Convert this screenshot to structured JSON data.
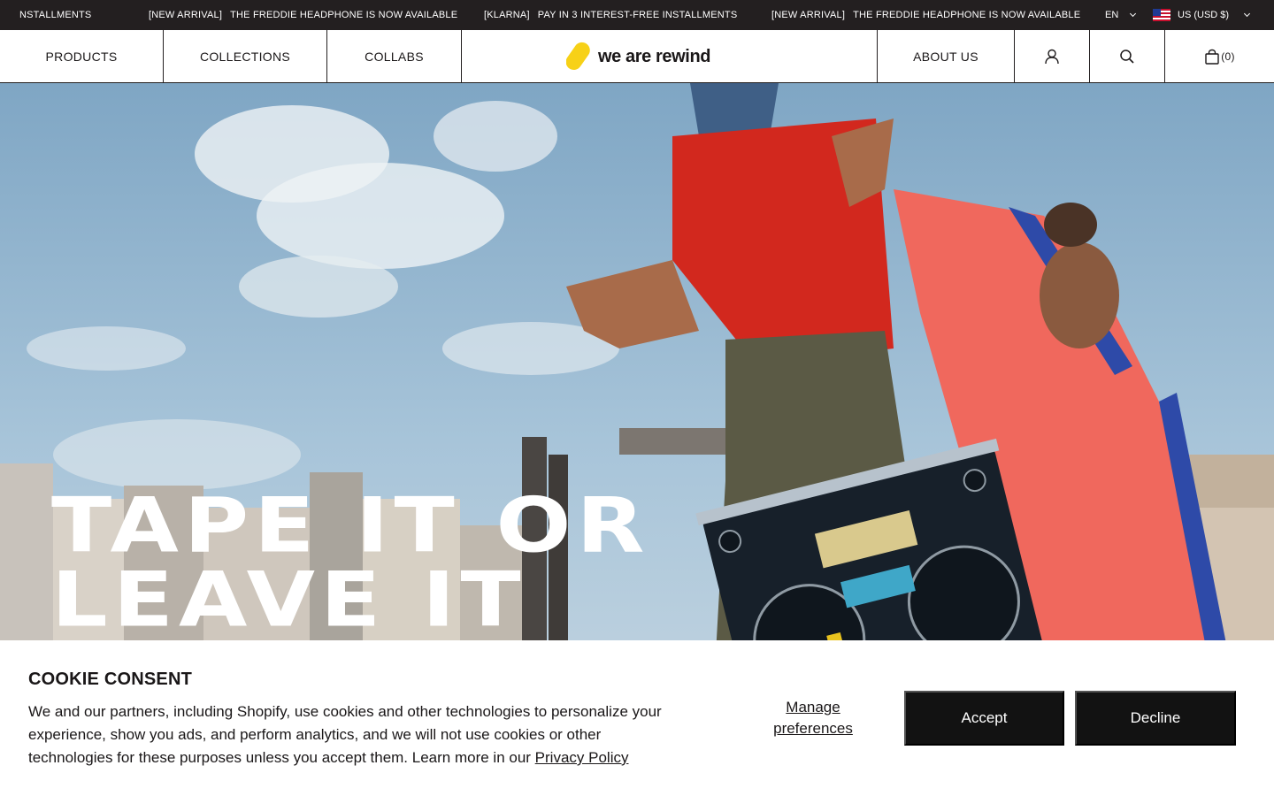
{
  "announcement": {
    "messages": [
      {
        "tag": "",
        "text": "NSTALLMENTS"
      },
      {
        "tag": "[NEW ARRIVAL]",
        "text": "THE FREDDIE HEADPHONE IS NOW AVAILABLE"
      },
      {
        "tag": "[KLARNA]",
        "text": "PAY IN 3 INTEREST-FREE INSTALLMENTS"
      },
      {
        "tag": "[NEW ARRIVAL]",
        "text": "THE FREDDIE HEADPHONE IS NOW AVAILABLE"
      }
    ],
    "language": "EN",
    "currency": "US (USD $)"
  },
  "nav": {
    "products": "PRODUCTS",
    "collections": "COLLECTIONS",
    "collabs": "COLLABS",
    "logo": "we are rewind",
    "about": "ABOUT US",
    "cart_count": "(0)"
  },
  "hero": {
    "headline_line1": "TAPE IT OR",
    "headline_line2": "LEAVE IT"
  },
  "cookie": {
    "title": "COOKIE CONSENT",
    "body": "We and our partners, including Shopify, use cookies and other technologies to personalize your experience, show you ads, and perform analytics, and we will not use cookies or other technologies for these purposes unless you accept them. Learn more in our ",
    "privacy_link": "Privacy Policy",
    "manage": "Manage preferences",
    "accept": "Accept",
    "decline": "Decline"
  },
  "colors": {
    "announcement_bg": "#231f20",
    "button_bg": "#121212",
    "logo_yellow": "#f7d117",
    "sky": "#9ebfd6"
  },
  "icons": [
    "chevron-down-icon",
    "us-flag-icon",
    "user-icon",
    "search-icon",
    "bag-icon",
    "logo-mark-icon"
  ]
}
